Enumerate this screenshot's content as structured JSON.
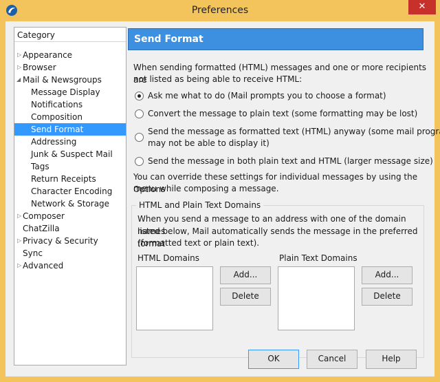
{
  "window": {
    "title": "Preferences",
    "close_glyph": "✕"
  },
  "sidebar": {
    "header": "Category",
    "items": [
      {
        "label": "Appearance",
        "expandable": true
      },
      {
        "label": "Browser",
        "expandable": true
      },
      {
        "label": "Mail & Newsgroups",
        "expanded": true
      },
      {
        "label": "Message Display"
      },
      {
        "label": "Notifications"
      },
      {
        "label": "Composition"
      },
      {
        "label": "Send Format",
        "selected": true
      },
      {
        "label": "Addressing"
      },
      {
        "label": "Junk & Suspect Mail"
      },
      {
        "label": "Tags"
      },
      {
        "label": "Return Receipts"
      },
      {
        "label": "Character Encoding"
      },
      {
        "label": "Network & Storage"
      },
      {
        "label": "Composer",
        "expandable": true
      },
      {
        "label": "ChatZilla"
      },
      {
        "label": "Privacy & Security",
        "expandable": true
      },
      {
        "label": "Sync"
      },
      {
        "label": "Advanced",
        "expandable": true
      }
    ]
  },
  "panel": {
    "title": "Send Format",
    "intro_line1": "When sending formatted (HTML) messages and one or more recipients are",
    "intro_line2": "not listed as being able to receive HTML:",
    "options": [
      {
        "label": "Ask me what to do (Mail prompts you to choose a format)",
        "checked": true
      },
      {
        "label": "Convert the message to plain text (some formatting may be lost)",
        "checked": false
      },
      {
        "label_line1": "Send the message as formatted text (HTML) anyway (some mail programs",
        "label_line2": "may not be able to display it)",
        "checked": false
      },
      {
        "label": "Send the message in both plain text and HTML (larger message size)",
        "checked": false
      }
    ],
    "override_line1": "You can override these settings for individual messages by using the Options",
    "override_line2": "menu while composing a message.",
    "domains": {
      "legend": "HTML and Plain Text Domains",
      "desc_line1": "When you send a message to an address with one of the domain names",
      "desc_line2": "listed below, Mail automatically sends the message in the preferred format",
      "desc_line3": "(formatted text or plain text).",
      "html_label": "HTML Domains",
      "plain_label": "Plain Text Domains",
      "add_label": "Add...",
      "delete_label": "Delete"
    }
  },
  "footer": {
    "ok": "OK",
    "cancel": "Cancel",
    "help": "Help"
  },
  "colors": {
    "titlebar": "#f3c35c",
    "banner": "#3d8fe0",
    "selection": "#3399ff",
    "close": "#c7312c"
  }
}
